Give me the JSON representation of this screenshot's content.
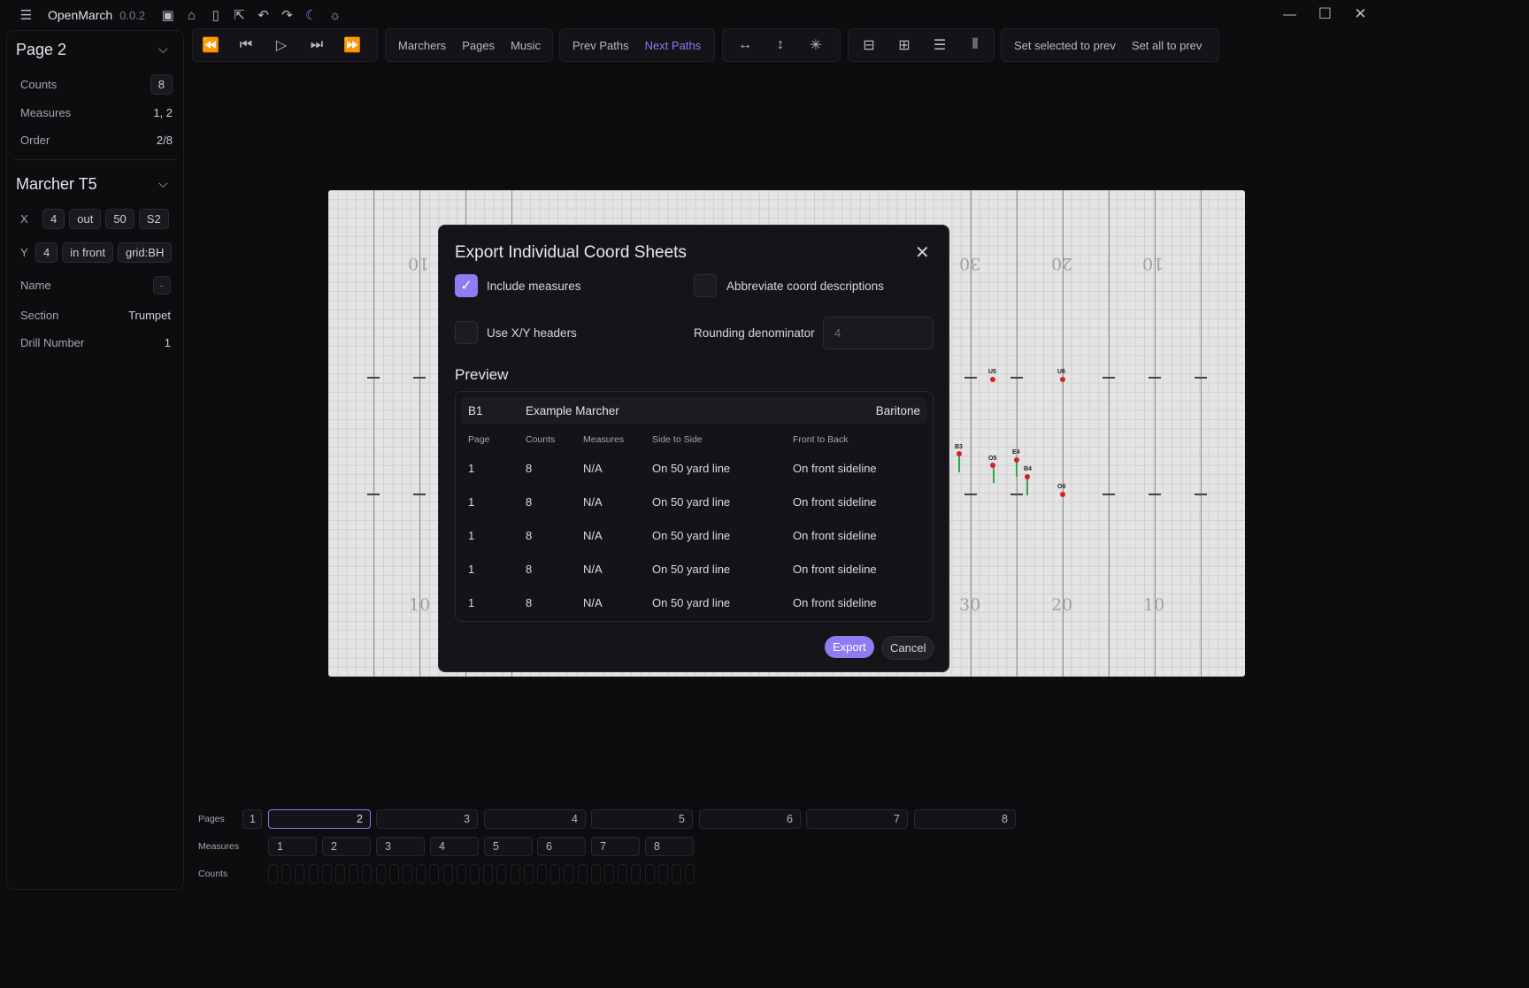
{
  "app": {
    "name": "OpenMarch",
    "version": "0.0.2"
  },
  "sidebar": {
    "page": {
      "title": "Page 2",
      "counts_label": "Counts",
      "counts_value": "8",
      "measures_label": "Measures",
      "measures_value": "1, 2",
      "order_label": "Order",
      "order_value": "2/8"
    },
    "marcher": {
      "title": "Marcher T5",
      "x_label": "X",
      "x_chips": [
        "4",
        "out",
        "50",
        "S2"
      ],
      "y_label": "Y",
      "y_chips": [
        "4",
        "in front",
        "grid:BH"
      ],
      "name_label": "Name",
      "name_value": "-",
      "section_label": "Section",
      "section_value": "Trumpet",
      "drill_label": "Drill Number",
      "drill_value": "1"
    }
  },
  "toolbar": {
    "views": [
      "Marchers",
      "Pages",
      "Music"
    ],
    "prev_paths": "Prev Paths",
    "next_paths": "Next Paths",
    "set_selected_prev": "Set selected to prev",
    "set_all_prev": "Set all to prev"
  },
  "field": {
    "numbers_top": [
      "10",
      "30",
      "20",
      "10"
    ],
    "numbers_bottom": [
      "10",
      "30",
      "20",
      "10"
    ],
    "marchers": [
      "U5",
      "U6",
      "B3",
      "O5",
      "E4",
      "B4",
      "O6"
    ]
  },
  "modal": {
    "title": "Export Individual Coord Sheets",
    "include_measures": "Include measures",
    "abbreviate": "Abbreviate coord descriptions",
    "xy_headers": "Use X/Y headers",
    "rounding_label": "Rounding denominator",
    "rounding_placeholder": "4",
    "preview_title": "Preview",
    "preview": {
      "drill_number": "B1",
      "marcher_name": "Example Marcher",
      "section": "Baritone",
      "columns": [
        "Page",
        "Counts",
        "Measures",
        "Side to Side",
        "Front to Back"
      ],
      "rows": [
        [
          "1",
          "8",
          "N/A",
          "On 50 yard line",
          "On front sideline"
        ],
        [
          "1",
          "8",
          "N/A",
          "On 50 yard line",
          "On front sideline"
        ],
        [
          "1",
          "8",
          "N/A",
          "On 50 yard line",
          "On front sideline"
        ],
        [
          "1",
          "8",
          "N/A",
          "On 50 yard line",
          "On front sideline"
        ],
        [
          "1",
          "8",
          "N/A",
          "On 50 yard line",
          "On front sideline"
        ]
      ]
    },
    "export_button": "Export",
    "cancel_button": "Cancel"
  },
  "timeline": {
    "pages_label": "Pages",
    "pages": [
      "1",
      "2",
      "3",
      "4",
      "5",
      "6",
      "7",
      "8"
    ],
    "measures_label": "Measures",
    "measures": [
      "1",
      "2",
      "3",
      "4",
      "5",
      "6",
      "7",
      "8"
    ],
    "counts_label": "Counts"
  }
}
